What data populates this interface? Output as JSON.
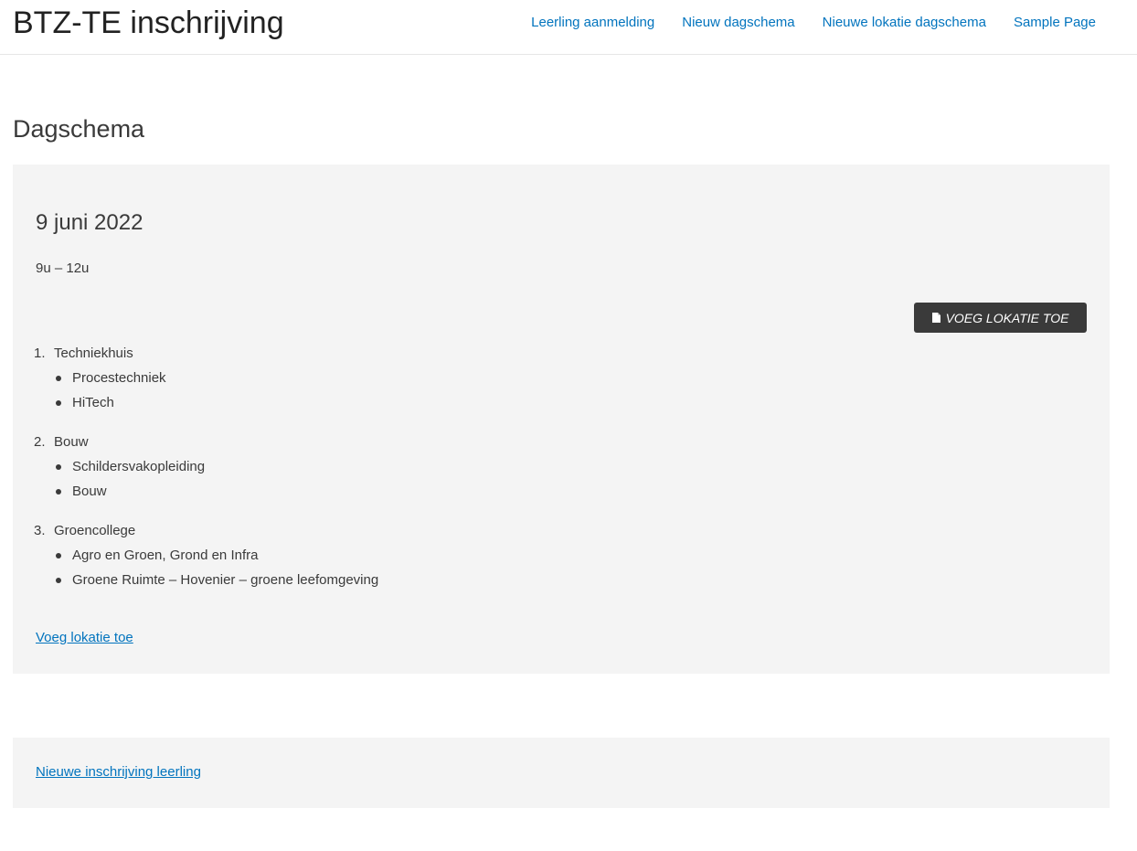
{
  "header": {
    "site_title": "BTZ-TE inschrijving",
    "nav": [
      {
        "label": "Leerling aanmelding"
      },
      {
        "label": "Nieuw dagschema"
      },
      {
        "label": "Nieuwe lokatie dagschema"
      },
      {
        "label": "Sample Page"
      }
    ]
  },
  "page": {
    "title": "Dagschema"
  },
  "schedule": {
    "date": "9 juni 2022",
    "time": "9u – 12u",
    "add_button_label": "Voeg lokatie toe",
    "add_button_icon": "document-icon",
    "locations": [
      {
        "number": "1.",
        "name": "Techniekhuis",
        "programs": [
          "Procestechniek",
          "HiTech"
        ]
      },
      {
        "number": "2.",
        "name": "Bouw",
        "programs": [
          "Schildersvakopleiding",
          "Bouw"
        ]
      },
      {
        "number": "3.",
        "name": "Groencollege",
        "programs": [
          "Agro en Groen, Grond en Infra",
          "Groene Ruimte – Hovenier – groene leefomgeving"
        ]
      }
    ],
    "add_link_label": "Voeg lokatie toe"
  },
  "footer": {
    "new_registration_link": "Nieuwe inschrijving leerling"
  },
  "colors": {
    "link": "#0274be",
    "text": "#3a3a3a",
    "card_bg": "#f4f4f4",
    "button_bg": "#3a3a3a"
  }
}
